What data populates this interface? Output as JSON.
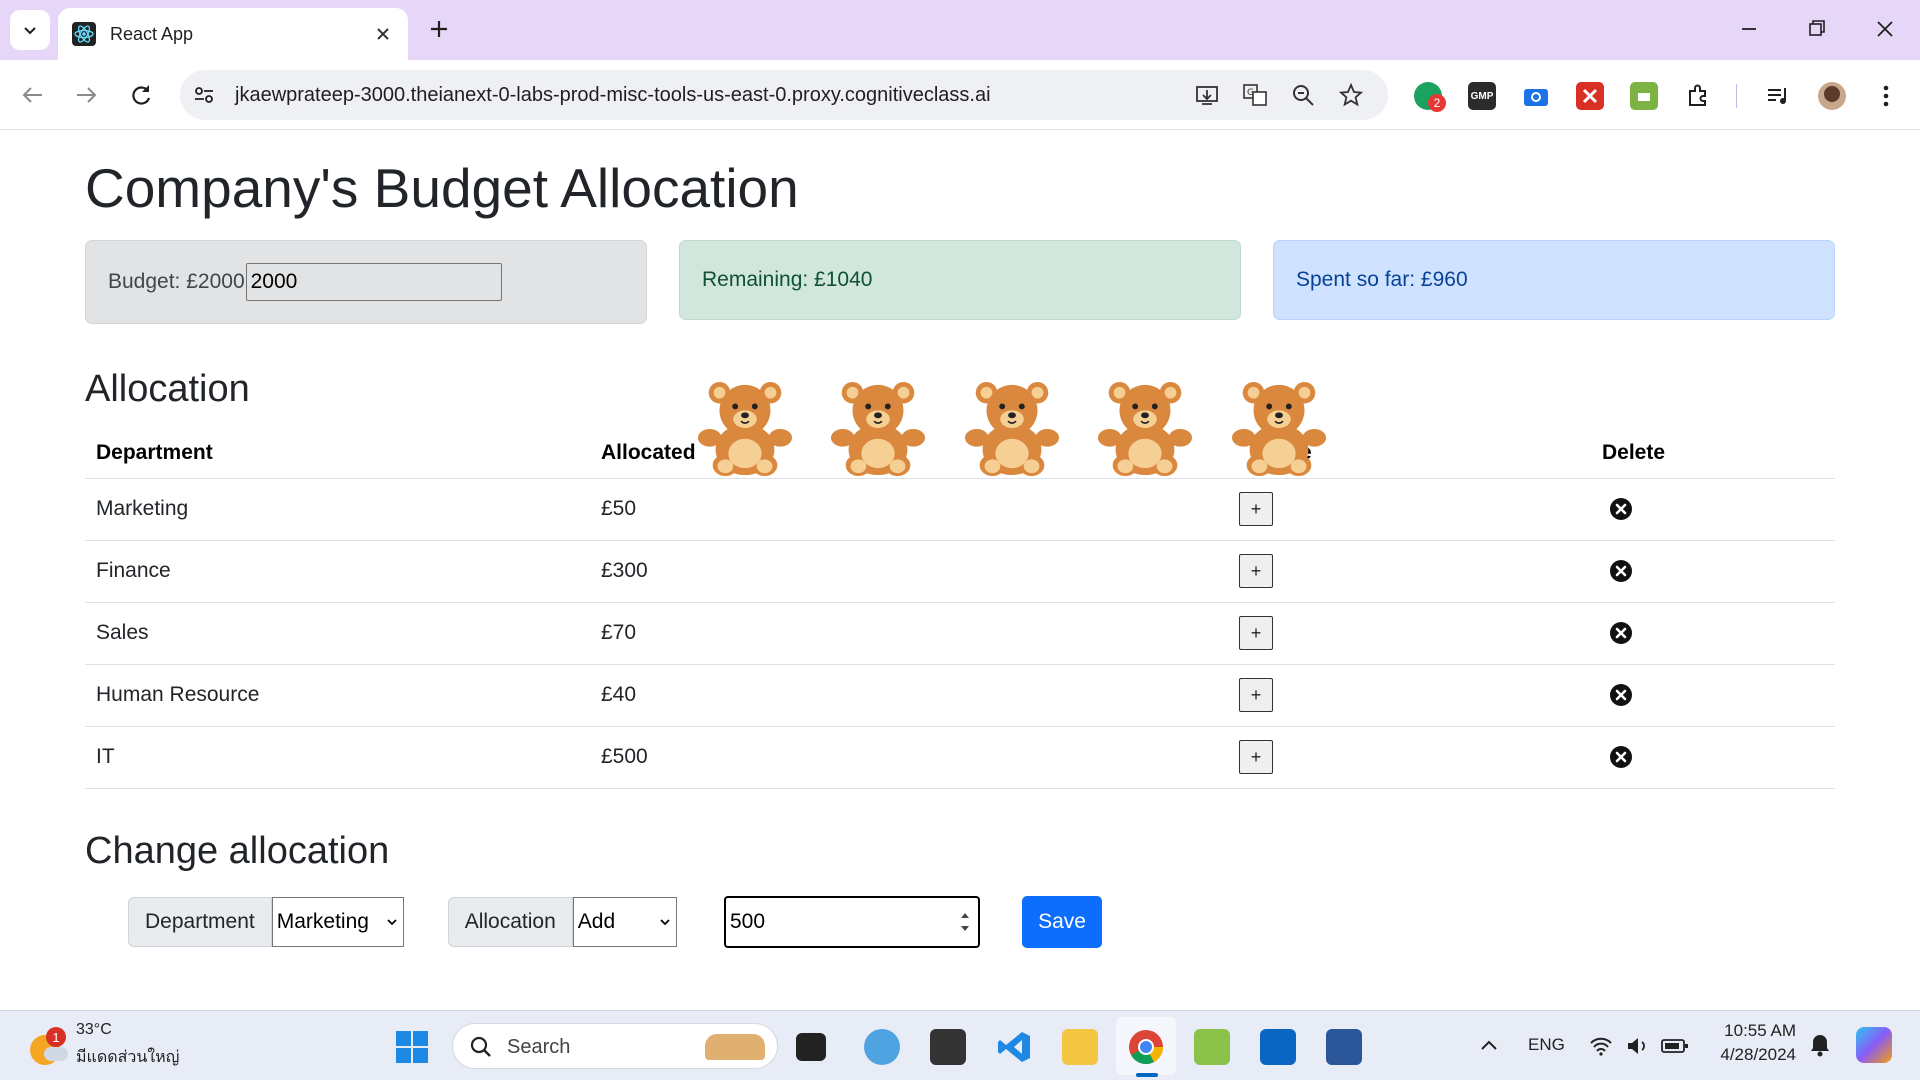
{
  "browser": {
    "tab_title": "React App",
    "url": "jkaewprateep-3000.theianext-0-labs-prod-misc-tools-us-east-0.proxy.cognitiveclass.ai",
    "extension_badge": "2",
    "gmp_label": "GMP"
  },
  "page": {
    "title": "Company's Budget Allocation",
    "budget_label": "Budget: £2000",
    "budget_value": "2000",
    "remaining_label": "Remaining: £1040",
    "spent_label": "Spent so far: £960",
    "allocation_heading": "Allocation",
    "table_headers": {
      "department": "Department",
      "allocated": "Allocated",
      "increase_partial": "ease",
      "delete": "Delete"
    },
    "rows": [
      {
        "department": "Marketing",
        "allocated": "£50",
        "increase": "+"
      },
      {
        "department": "Finance",
        "allocated": "£300",
        "increase": "+"
      },
      {
        "department": "Sales",
        "allocated": "£70",
        "increase": "+"
      },
      {
        "department": "Human Resource",
        "allocated": "£40",
        "increase": "+"
      },
      {
        "department": "IT",
        "allocated": "£500",
        "increase": "+"
      }
    ],
    "change_heading": "Change allocation",
    "department_label": "Department",
    "department_selected": "Marketing",
    "allocation_label": "Allocation",
    "allocation_selected": "Add",
    "amount_value": "500",
    "save_label": "Save"
  },
  "taskbar": {
    "weather_badge": "1",
    "weather_temp": "33°C",
    "weather_desc": "มีแดดส่วนใหญ่",
    "search_label": "Search",
    "language": "ENG",
    "time": "10:55 AM",
    "date": "4/28/2024"
  },
  "colors": {
    "tabbar_bg": "#e6d6f7",
    "primary": "#0d6efd",
    "secondary_alert": "#e2e3e5",
    "success_alert": "#d1e7dd",
    "primary_alert": "#cfe2ff"
  },
  "icons": {
    "bears": [
      "teddy-bear-icon",
      "teddy-bear-icon",
      "teddy-bear-icon",
      "teddy-bear-icon",
      "teddy-bear-icon"
    ]
  }
}
